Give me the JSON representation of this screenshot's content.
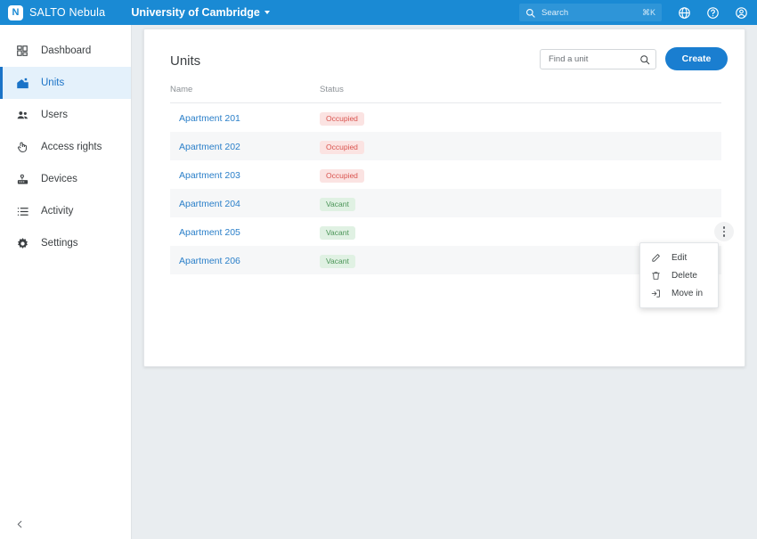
{
  "topbar": {
    "logo_letter": "N",
    "brand_name": "SALTO Nebula",
    "org_name": "University of Cambridge",
    "search_placeholder": "Search",
    "search_shortcut": "⌘K",
    "icons": [
      "globe-icon",
      "help-icon",
      "account-icon"
    ],
    "background_color": "#1a8ad4"
  },
  "sidebar": {
    "items": [
      {
        "label": "Dashboard",
        "icon": "dashboard-icon",
        "active": false
      },
      {
        "label": "Units",
        "icon": "units-icon",
        "active": true
      },
      {
        "label": "Users",
        "icon": "users-icon",
        "active": false
      },
      {
        "label": "Access rights",
        "icon": "access-rights-icon",
        "active": false
      },
      {
        "label": "Devices",
        "icon": "devices-icon",
        "active": false
      },
      {
        "label": "Activity",
        "icon": "activity-icon",
        "active": false
      },
      {
        "label": "Settings",
        "icon": "settings-icon",
        "active": false
      }
    ],
    "collapse_icon": "chevron-left-icon",
    "active_color": "#1a73c7"
  },
  "main": {
    "title": "Units",
    "find_placeholder": "Find a unit",
    "find_icon": "search-icon",
    "create_label": "Create",
    "create_color": "#1a7ed0",
    "table": {
      "columns": [
        "Name",
        "Status"
      ],
      "rows": [
        {
          "name": "Apartment 201",
          "status": "Occupied",
          "status_type": "occupied"
        },
        {
          "name": "Apartment 202",
          "status": "Occupied",
          "status_type": "occupied"
        },
        {
          "name": "Apartment 203",
          "status": "Occupied",
          "status_type": "occupied"
        },
        {
          "name": "Apartment 204",
          "status": "Vacant",
          "status_type": "vacant"
        },
        {
          "name": "Apartment 205",
          "status": "Vacant",
          "status_type": "vacant"
        },
        {
          "name": "Apartment 206",
          "status": "Vacant",
          "status_type": "vacant"
        }
      ],
      "occupied_color": "#d9544f",
      "vacant_color": "#4b9558",
      "link_color": "#2a7fc9"
    }
  },
  "context_menu": {
    "open_for_row_index": 4,
    "items": [
      {
        "label": "Edit",
        "icon": "pencil-icon"
      },
      {
        "label": "Delete",
        "icon": "trash-icon"
      },
      {
        "label": "Move in",
        "icon": "move-in-icon"
      }
    ]
  }
}
